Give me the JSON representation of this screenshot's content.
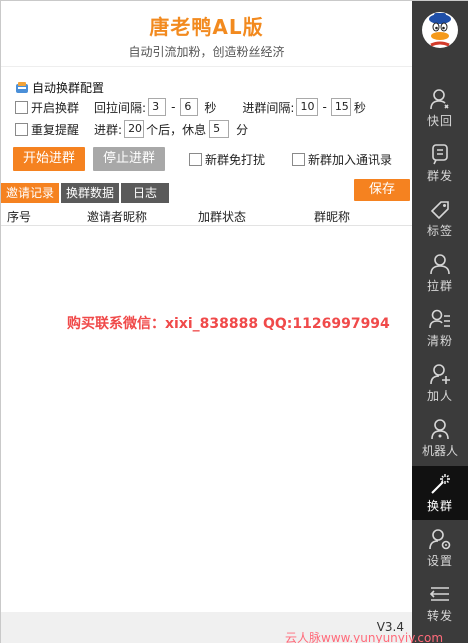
{
  "header": {
    "title": "唐老鸭AL版",
    "subtitle": "自动引流加粉，创造粉丝经济"
  },
  "config": {
    "section_title": "自动换群配置",
    "open_group_label": "开启换群",
    "pull_interval_label": "回拉间隔:",
    "pull_min": "3",
    "pull_max": "6",
    "unit_seconds": "秒",
    "join_interval_label": "进群间隔:",
    "join_min": "10",
    "join_max": "15",
    "dash": "-",
    "repeat_remind_label": "重复提醒",
    "join_after_label": "进群:",
    "join_count": "20",
    "rest_label": "个后，休息",
    "rest_value": "5",
    "unit_minutes": "分",
    "start_button": "开始进群",
    "stop_button": "停止进群",
    "no_disturb_label": "新群免打扰",
    "add_contacts_label": "新群加入通讯录"
  },
  "tabs": [
    {
      "label": "邀请记录",
      "active": true
    },
    {
      "label": "换群数据",
      "active": false
    },
    {
      "label": "日志",
      "active": false
    }
  ],
  "save_button": "保存",
  "table": {
    "columns": [
      "序号",
      "邀请者昵称",
      "加群状态",
      "群昵称"
    ]
  },
  "watermark": "购买联系微信：xixi_838888    QQ:1126997994",
  "footer": {
    "version": "V3.4",
    "credit": "云人脉www.yunyunyiy.com"
  },
  "sidebar": {
    "items": [
      {
        "label": "快回",
        "icon": "quick-reply-icon"
      },
      {
        "label": "群发",
        "icon": "mass-send-icon"
      },
      {
        "label": "标签",
        "icon": "tag-icon"
      },
      {
        "label": "拉群",
        "icon": "pull-group-icon"
      },
      {
        "label": "清粉",
        "icon": "clean-fans-icon"
      },
      {
        "label": "加人",
        "icon": "add-person-icon"
      },
      {
        "label": "机器人",
        "icon": "robot-icon"
      },
      {
        "label": "换群",
        "icon": "magic-wand-icon",
        "active": true
      },
      {
        "label": "设置",
        "icon": "settings-icon"
      },
      {
        "label": "转发",
        "icon": "forward-icon"
      }
    ]
  },
  "colors": {
    "accent": "#f58220",
    "sidebar_bg": "#3b3b3b",
    "sidebar_active": "#111111",
    "watermark": "#f04a4a"
  }
}
